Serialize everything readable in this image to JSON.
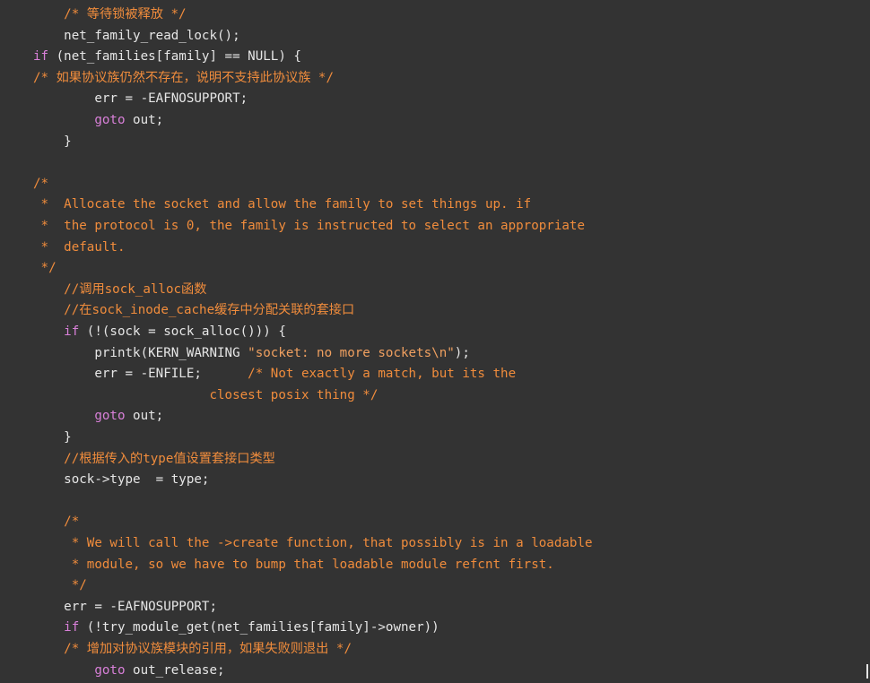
{
  "theme": {
    "background": "#333333",
    "text": "#e6e6e6",
    "keyword": "#d980d9",
    "comment": "#f08c3c",
    "string": "#f0a060"
  },
  "code": {
    "lines": [
      [
        {
          "t": "    ",
          "k": "nm"
        },
        {
          "t": "/* 等待锁被释放 */",
          "k": "cm"
        }
      ],
      [
        {
          "t": "    net_family_read_lock();",
          "k": "nm"
        }
      ],
      [
        {
          "t": "if",
          "k": "kw"
        },
        {
          "t": " (net_families[family] == NULL) {",
          "k": "nm"
        }
      ],
      [
        {
          "t": "/* 如果协议族仍然不存在，说明不支持此协议族 */",
          "k": "cm"
        }
      ],
      [
        {
          "t": "        err = -EAFNOSUPPORT;",
          "k": "nm"
        }
      ],
      [
        {
          "t": "        ",
          "k": "nm"
        },
        {
          "t": "goto",
          "k": "kw"
        },
        {
          "t": " out;",
          "k": "nm"
        }
      ],
      [
        {
          "t": "    }",
          "k": "nm"
        }
      ],
      [
        {
          "t": "",
          "k": "nm"
        }
      ],
      [
        {
          "t": "/*",
          "k": "cm"
        }
      ],
      [
        {
          "t": " *  Allocate the socket and allow the family to set things up. if",
          "k": "cm"
        }
      ],
      [
        {
          "t": " *  the protocol is 0, the family is instructed to select an appropriate",
          "k": "cm"
        }
      ],
      [
        {
          "t": " *  default.",
          "k": "cm"
        }
      ],
      [
        {
          "t": " */",
          "k": "cm"
        }
      ],
      [
        {
          "t": "    ",
          "k": "nm"
        },
        {
          "t": "//调用sock_alloc函数",
          "k": "cm"
        }
      ],
      [
        {
          "t": "    ",
          "k": "nm"
        },
        {
          "t": "//在sock_inode_cache缓存中分配关联的套接口",
          "k": "cm"
        }
      ],
      [
        {
          "t": "    ",
          "k": "nm"
        },
        {
          "t": "if",
          "k": "kw"
        },
        {
          "t": " (!(sock = sock_alloc())) {",
          "k": "nm"
        }
      ],
      [
        {
          "t": "        printk(KERN_WARNING ",
          "k": "nm"
        },
        {
          "t": "\"socket: no more sockets\\n\"",
          "k": "str"
        },
        {
          "t": ");",
          "k": "nm"
        }
      ],
      [
        {
          "t": "        err = -ENFILE;      ",
          "k": "nm"
        },
        {
          "t": "/* Not exactly a match, but its the",
          "k": "cm"
        }
      ],
      [
        {
          "t": "                       closest posix thing */",
          "k": "cm"
        }
      ],
      [
        {
          "t": "        ",
          "k": "nm"
        },
        {
          "t": "goto",
          "k": "kw"
        },
        {
          "t": " out;",
          "k": "nm"
        }
      ],
      [
        {
          "t": "    }",
          "k": "nm"
        }
      ],
      [
        {
          "t": "    ",
          "k": "nm"
        },
        {
          "t": "//根据传入的type值设置套接口类型",
          "k": "cm"
        }
      ],
      [
        {
          "t": "    sock->type  = type;",
          "k": "nm"
        }
      ],
      [
        {
          "t": "",
          "k": "nm"
        }
      ],
      [
        {
          "t": "    ",
          "k": "nm"
        },
        {
          "t": "/*",
          "k": "cm"
        }
      ],
      [
        {
          "t": "     * We will call the ->create function, that possibly is in a loadable",
          "k": "cm"
        }
      ],
      [
        {
          "t": "     * module, so we have to bump that loadable module refcnt first.",
          "k": "cm"
        }
      ],
      [
        {
          "t": "     */",
          "k": "cm"
        }
      ],
      [
        {
          "t": "    err = -EAFNOSUPPORT;",
          "k": "nm"
        }
      ],
      [
        {
          "t": "    ",
          "k": "nm"
        },
        {
          "t": "if",
          "k": "kw"
        },
        {
          "t": " (!try_module_get(net_families[family]->owner))",
          "k": "nm"
        }
      ],
      [
        {
          "t": "    ",
          "k": "nm"
        },
        {
          "t": "/* 增加对协议族模块的引用，如果失败则退出 */",
          "k": "cm"
        }
      ],
      [
        {
          "t": "        ",
          "k": "nm"
        },
        {
          "t": "goto",
          "k": "kw"
        },
        {
          "t": " out_release;",
          "k": "nm"
        }
      ]
    ]
  }
}
